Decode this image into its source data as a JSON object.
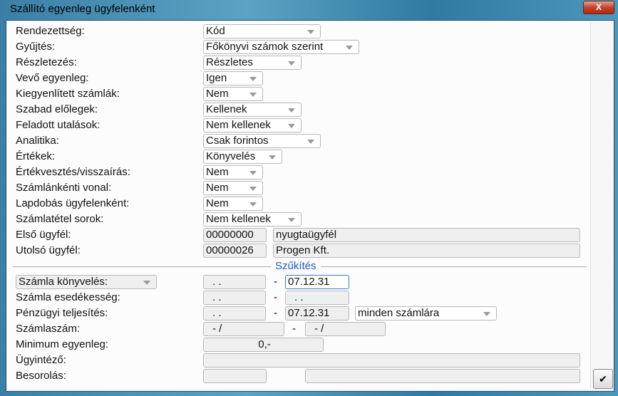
{
  "window": {
    "title": "Szállító egyenleg ügyfelenként",
    "close_label": "X"
  },
  "options": [
    {
      "label": "Rendezettség:",
      "value": "Kód"
    },
    {
      "label": "Gyűjtés:",
      "value": "Főkönyvi számok szerint"
    },
    {
      "label": "Részletezés:",
      "value": "Részletes"
    },
    {
      "label": "Vevő egyenleg:",
      "value": "Igen"
    },
    {
      "label": "Kiegyenlített számlák:",
      "value": "Nem"
    },
    {
      "label": "Szabad előlegek:",
      "value": "Kellenek"
    },
    {
      "label": "Feladott utalások:",
      "value": "Nem kellenek"
    },
    {
      "label": "Analitika:",
      "value": "Csak forintos"
    },
    {
      "label": "Értékek:",
      "value": "Könyvelés"
    },
    {
      "label": "Értékvesztés/visszaírás:",
      "value": "Nem"
    },
    {
      "label": "Számlánkénti vonal:",
      "value": "Nem"
    },
    {
      "label": "Lapdobás ügyfelenként:",
      "value": "Nem"
    },
    {
      "label": "Számlatétel sorok:",
      "value": "Nem kellenek"
    }
  ],
  "first_customer": {
    "label": "Első ügyfél:",
    "code": "00000000",
    "name": "nyugtaügyfél"
  },
  "last_customer": {
    "label": "Utolsó ügyfél:",
    "code": "00000026",
    "name": "Progen Kft."
  },
  "filter": {
    "section_title": "Szűkítés",
    "date_type": "Számla könyvelés:",
    "booking_from": ". .",
    "booking_to": "07.12.31",
    "due_label": "Számla esedékesség:",
    "due_from": ". .",
    "due_to": ". .",
    "payment_label": "Pénzügyi teljesítés:",
    "payment_from": ". .",
    "payment_to": "07.12.31",
    "payment_scope": "minden számlára",
    "invoice_label": "Számlaszám:",
    "invoice_from": "- /",
    "invoice_to": "- /",
    "min_label": "Minimum egyenleg:",
    "min_value": "0,-",
    "agent_label": "Ügyintéző:",
    "agent_value": "",
    "class_label": "Besorolás:",
    "class_a": "",
    "class_b": "",
    "dash": "-"
  },
  "ok_label": "✔"
}
